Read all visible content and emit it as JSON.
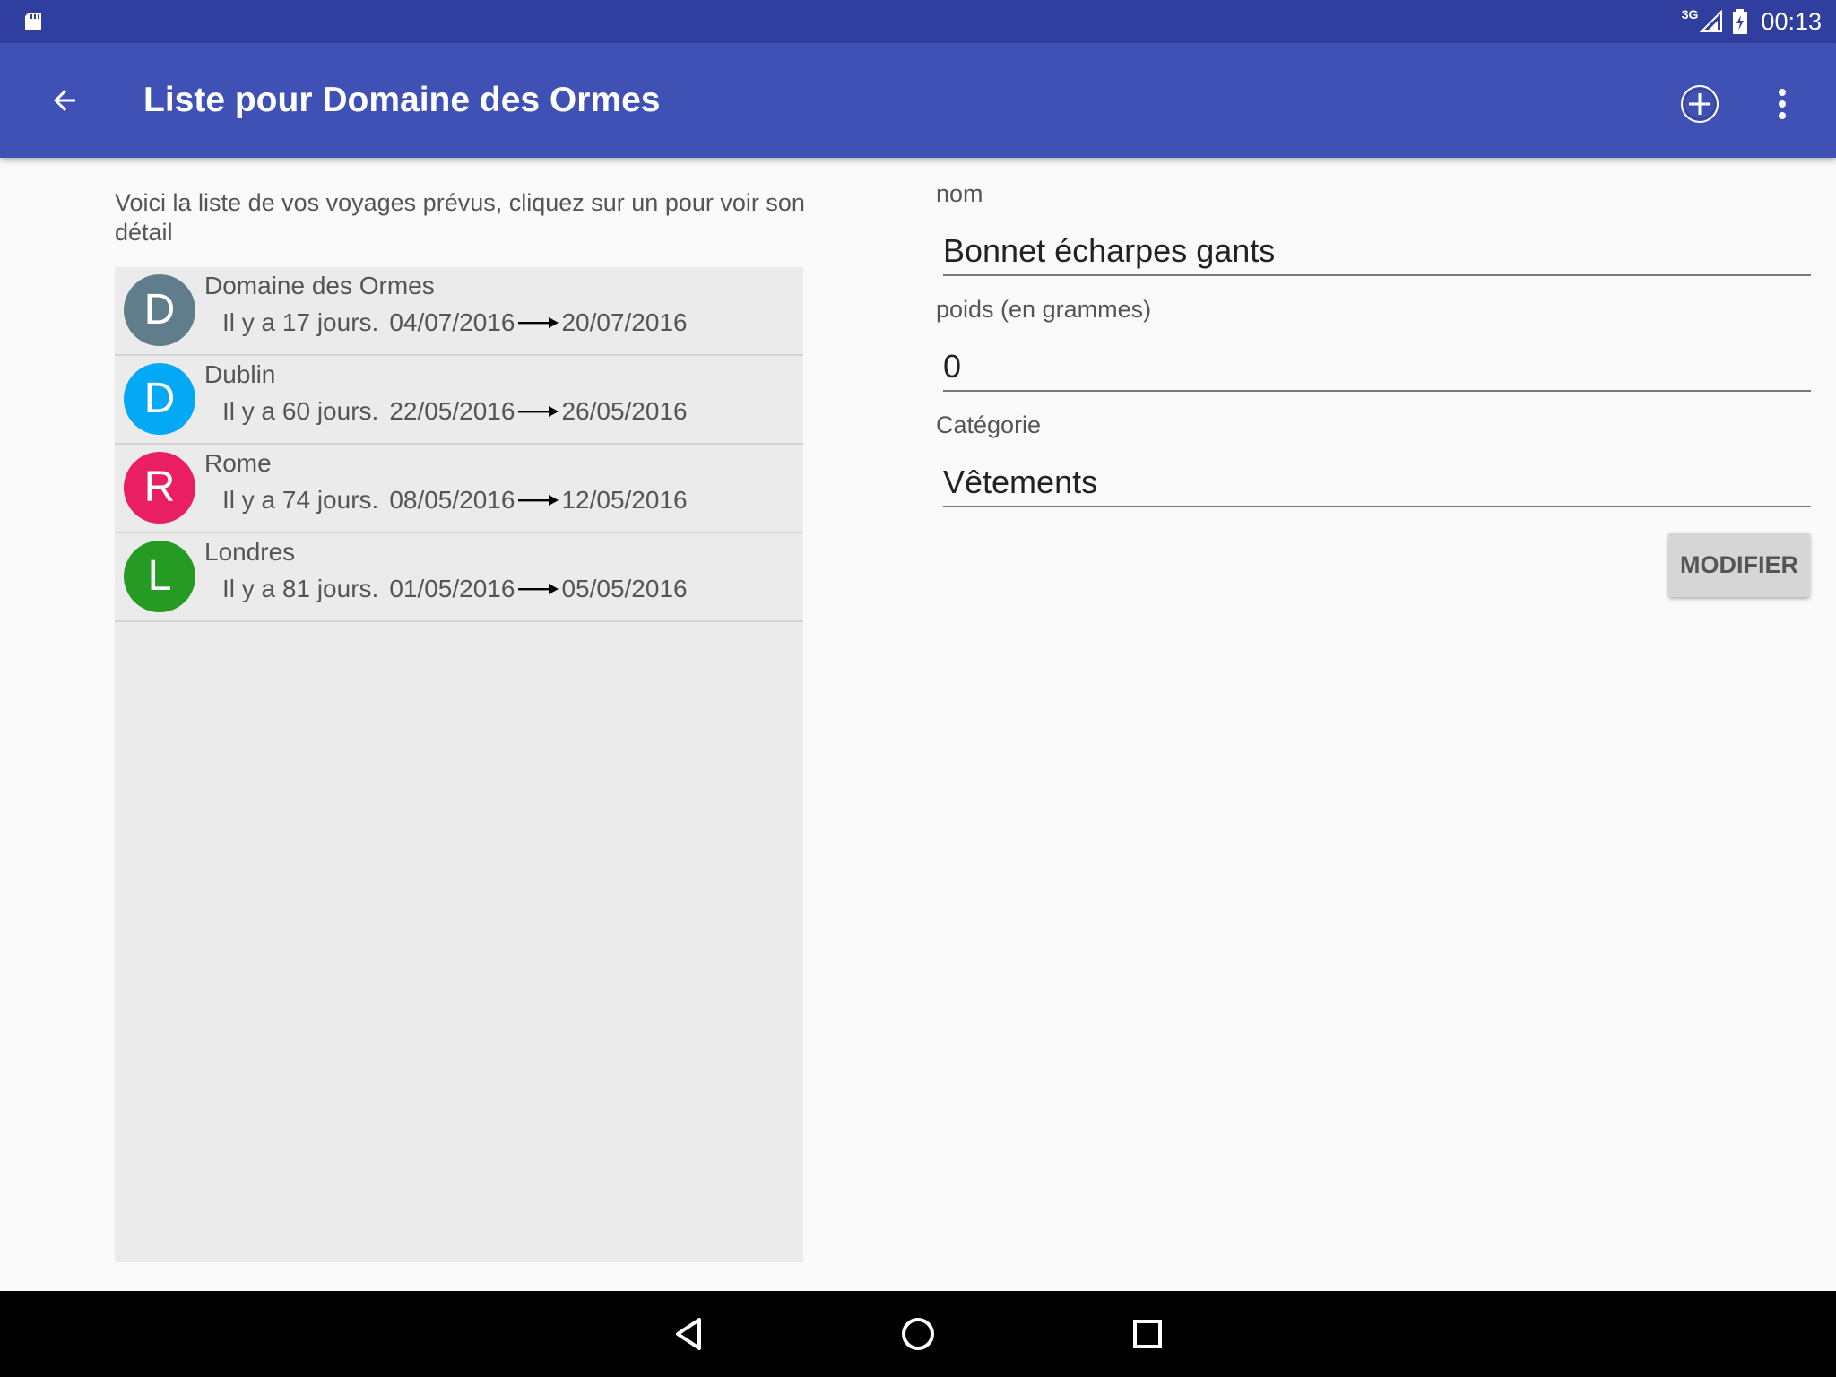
{
  "colors": {
    "status_bar": "#303f9f",
    "toolbar": "#3f51b5",
    "list_bg": "#ebebeb",
    "nav_bar": "#000000"
  },
  "status_bar": {
    "left_icon": "sd-card-icon",
    "network_type": "3G",
    "signal_icon": "signal-icon",
    "battery_icon": "battery-charging-icon",
    "time": "00:13"
  },
  "toolbar": {
    "back_icon": "arrow-back-icon",
    "title": "Liste pour Domaine des Ormes",
    "add_icon": "add-circle-icon",
    "more_icon": "more-vert-icon"
  },
  "intro_text": "Voici la liste de vos voyages prévus, cliquez sur un pour voir son détail",
  "trips": [
    {
      "initial": "D",
      "name": "Domaine des Ormes",
      "ago": "Il y a 17 jours.",
      "start": "04/07/2016",
      "end": "20/07/2016",
      "color": "#607d8b"
    },
    {
      "initial": "D",
      "name": "Dublin",
      "ago": "Il y a 60 jours.",
      "start": "22/05/2016",
      "end": "26/05/2016",
      "color": "#03a9f4"
    },
    {
      "initial": "R",
      "name": "Rome",
      "ago": "Il y a 74 jours.",
      "start": "08/05/2016",
      "end": "12/05/2016",
      "color": "#e91e63"
    },
    {
      "initial": "L",
      "name": "Londres",
      "ago": "Il y a 81 jours.",
      "start": "01/05/2016",
      "end": "05/05/2016",
      "color": "#259b24"
    }
  ],
  "form": {
    "name_label": "nom",
    "name_value": "Bonnet écharpes gants",
    "weight_label": "poids (en grammes)",
    "weight_value": "0",
    "category_label": "Catégorie",
    "category_value": "Vêtements",
    "modify_button": "MODIFIER"
  },
  "nav_bar": {
    "back_icon": "nav-back-icon",
    "home_icon": "nav-home-icon",
    "recents_icon": "nav-recents-icon"
  }
}
